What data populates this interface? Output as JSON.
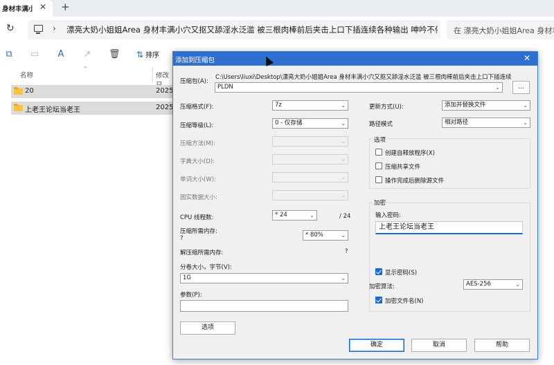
{
  "browser": {
    "tab_title": "身材丰满小",
    "tab_close": "✕",
    "new_tab": "+"
  },
  "address": {
    "path": "漂亮大奶小姐姐Area 身材丰满小穴又抠又舔淫水泛滥 被三根肉棒前后夹击上口下插连续各种输出 呻吟不停",
    "search_placeholder": "在 漂亮大奶小姐姐Area 身材丰满小穴又抠又"
  },
  "toolbar": {
    "sort_label": "排序"
  },
  "columns": {
    "name": "名称",
    "date": "修改日"
  },
  "files": [
    {
      "name": "20",
      "date": "2025"
    },
    {
      "name": "上老王论坛当老王",
      "date": "2025"
    }
  ],
  "dialog": {
    "title": "添加到压缩包",
    "archive_label": "压缩包(A):",
    "archive_dir": "C:\\Users\\liuxi\\Desktop\\漂亮大奶小姐姐Area 身材丰满小穴又抠又舔淫水泛滥 被三根肉棒前后夹击上口下插连续",
    "archive_name": "PLDN",
    "browse_label": "...",
    "format_label": "压缩格式(F):",
    "format_value": "7z",
    "level_label": "压缩等级(L):",
    "level_value": "0 - 仅存储",
    "method_label": "压缩方法(M):",
    "dict_label": "字典大小(D):",
    "word_label": "单词大小(W):",
    "solid_label": "固实数据大小:",
    "cpu_label": "CPU 线程数:",
    "cpu_value": "* 24",
    "cpu_max": "/ 24",
    "mem_compress_label": "压缩所需内存:",
    "mem_compress_q": "?",
    "mem_compress_value": "* 80%",
    "mem_decompress_label": "解压缩所需内存:",
    "mem_decompress_value": "?",
    "volume_label": "分卷大小，字节(V):",
    "volume_value": "1G",
    "params_label": "参数(P):",
    "options_button": "选项",
    "update_label": "更新方式(U):",
    "update_value": "添加并替换文件",
    "pathmode_label": "路径模式",
    "pathmode_value": "相对路径",
    "options_group": "选项",
    "opt_sfx": "创建自释放程序(X)",
    "opt_shared": "压缩共享文件",
    "opt_delete": "操作完成后删除源文件",
    "encrypt_group": "加密",
    "password_label": "输入密码:",
    "password_value": "上老王论坛当老王",
    "show_password": "显示密码(S)",
    "enc_method_label": "加密算法:",
    "enc_method_value": "AES-256",
    "encrypt_names": "加密文件名(N)",
    "ok": "确定",
    "cancel": "取消",
    "help": "帮助"
  }
}
